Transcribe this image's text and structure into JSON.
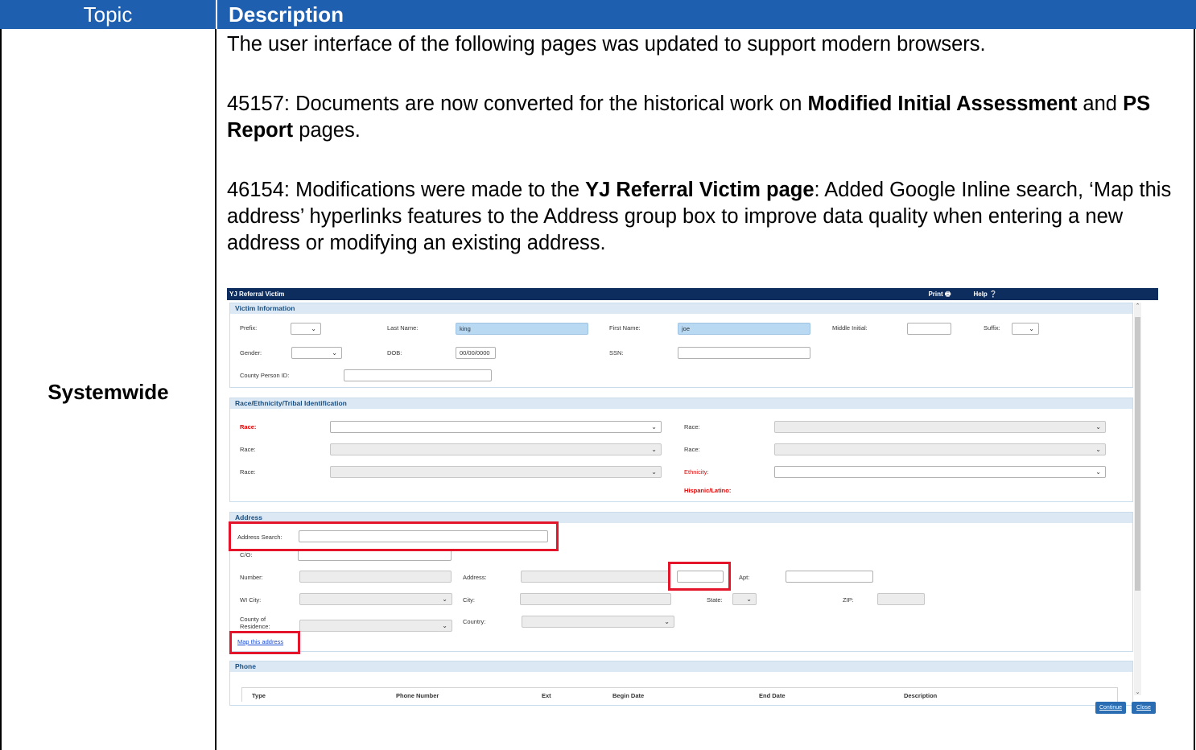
{
  "table": {
    "header_topic": "Topic",
    "header_description": "Description",
    "topic": "Systemwide",
    "para1": "The user interface of the following pages was updated to support modern browsers.",
    "para2": {
      "a": "45157: Documents are now converted for the historical work on ",
      "b": "Modified Initial Assessment",
      "c": " and ",
      "d": "PS Report",
      "e": " pages."
    },
    "para3": {
      "a": "46154: Modifications were made to the ",
      "b": "YJ Referral Victim page",
      "c": ": Added Google Inline search, ‘Map this address’ hyperlinks features to the Address group box to improve data quality when entering a new address or modifying an existing address."
    }
  },
  "screenshot": {
    "title": "YJ Referral Victim",
    "print": "Print",
    "help": "Help",
    "victim": {
      "header": "Victim Information",
      "prefix": "Prefix:",
      "last_name": "Last Name:",
      "last_name_value": "king",
      "first_name": "First Name:",
      "first_name_value": "joe",
      "middle_initial": "Middle Initial:",
      "suffix": "Suffix:",
      "gender": "Gender:",
      "dob": "DOB:",
      "dob_value": "00/00/0000",
      "ssn": "SSN:",
      "county_person_id": "County Person ID:"
    },
    "race": {
      "header": "Race/Ethnicity/Tribal Identification",
      "race": "Race:",
      "ethnicity": "Ethnicity:",
      "hispanic": "Hispanic/Latino:"
    },
    "address": {
      "header": "Address",
      "search": "Address Search:",
      "co": "C/O:",
      "number": "Number:",
      "address": "Address:",
      "apt": "Apt:",
      "wi_city": "WI City:",
      "city": "City:",
      "state": "State:",
      "zip": "ZIP:",
      "county_of": "County of",
      "residence": "Residence:",
      "country": "Country:",
      "map_link": "Map this address"
    },
    "phone": {
      "header": "Phone",
      "columns": [
        "Type",
        "Phone Number",
        "Ext",
        "Begin Date",
        "End Date",
        "Description"
      ]
    },
    "buttons": {
      "continue": "Continue",
      "close": "Close"
    }
  }
}
